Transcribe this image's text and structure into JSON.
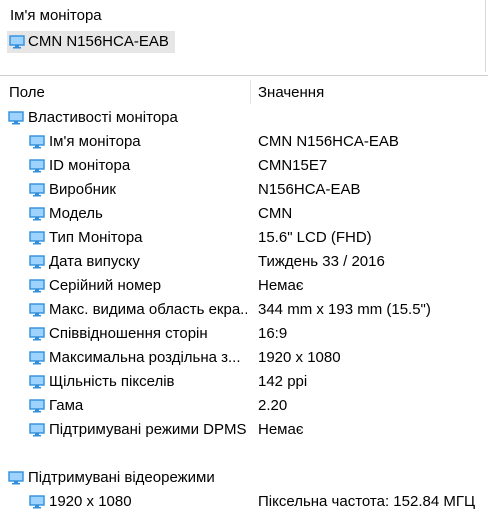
{
  "header": {
    "label": "Ім'я монітора",
    "device_name": "CMN N156HCA-EAB",
    "device_icon": "monitor-icon"
  },
  "columns": {
    "field": "Поле",
    "value": "Значення"
  },
  "sections": {
    "monitor_properties": {
      "title": "Властивості монітора",
      "icon": "monitor-icon",
      "rows": [
        {
          "label": "Ім'я монітора",
          "value": "CMN N156HCA-EAB"
        },
        {
          "label": "ID монітора",
          "value": "CMN15E7"
        },
        {
          "label": "Виробник",
          "value": "N156HCA-EAB"
        },
        {
          "label": "Модель",
          "value": "CMN"
        },
        {
          "label": "Тип Монітора",
          "value": "15.6\" LCD (FHD)"
        },
        {
          "label": "Дата випуску",
          "value": "Тиждень 33 / 2016"
        },
        {
          "label": "Серійний номер",
          "value": "Немає"
        },
        {
          "label": "Макс. видима область екра...",
          "value": "344 mm x 193 mm (15.5\")"
        },
        {
          "label": "Співвідношення сторін",
          "value": "16:9"
        },
        {
          "label": "Максимальна роздільна з...",
          "value": "1920 x 1080"
        },
        {
          "label": "Щільність пікселів",
          "value": "142 ppi"
        },
        {
          "label": "Гама",
          "value": "2.20"
        },
        {
          "label": "Підтримувані режими DPMS",
          "value": "Немає"
        }
      ]
    },
    "video_modes": {
      "title": "Підтримувані відеорежими",
      "icon": "monitor-icon",
      "rows": [
        {
          "label": "1920 x 1080",
          "value": "Піксельна частота: 152.84 МГЦ"
        }
      ]
    }
  },
  "colors": {
    "icon_blue": "#2f8fdd",
    "icon_light": "#9fd3ff",
    "chip_bg": "#e6e6e6"
  }
}
